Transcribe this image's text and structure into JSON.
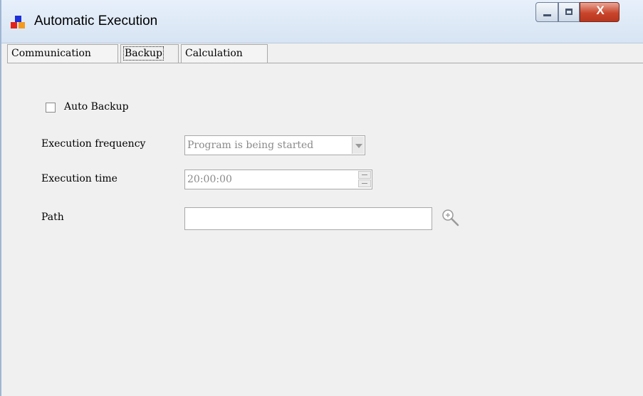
{
  "window": {
    "title": "Automatic Execution",
    "icon": "app-blocks-icon",
    "controls": {
      "minimize": "minimize-icon",
      "maximize": "maximize-icon",
      "close_label": "X"
    }
  },
  "tabs": [
    {
      "label": "Communication",
      "selected": false
    },
    {
      "label": "Backup",
      "selected": true
    },
    {
      "label": "Calculation",
      "selected": false
    }
  ],
  "backup": {
    "auto_backup": {
      "label": "Auto Backup",
      "checked": false
    },
    "frequency": {
      "label": "Execution frequency",
      "value": "Program is being started",
      "disabled": true
    },
    "time": {
      "label": "Execution time",
      "value": "20:00:00",
      "disabled": true
    },
    "path": {
      "label": "Path",
      "value": "",
      "browse_icon": "zoom-in-icon"
    }
  },
  "colors": {
    "icon_blue": "#1c2fd8",
    "icon_red": "#e2231a",
    "icon_orange": "#f39a1e",
    "close_red": "#c9452c"
  }
}
